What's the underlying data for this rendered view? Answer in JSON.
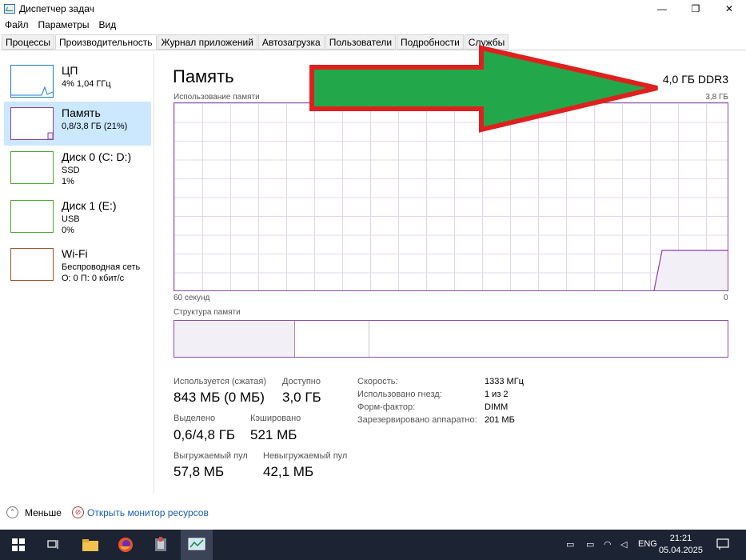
{
  "window": {
    "title": "Диспетчер задач",
    "minimize_glyph": "—",
    "restore_glyph": "❐",
    "close_glyph": "✕"
  },
  "menu": [
    "Файл",
    "Параметры",
    "Вид"
  ],
  "tabs": [
    {
      "label": "Процессы",
      "active": false
    },
    {
      "label": "Производительность",
      "active": true
    },
    {
      "label": "Журнал приложений",
      "active": false
    },
    {
      "label": "Автозагрузка",
      "active": false
    },
    {
      "label": "Пользователи",
      "active": false
    },
    {
      "label": "Подробности",
      "active": false
    },
    {
      "label": "Службы",
      "active": false
    }
  ],
  "sidebar": {
    "items": [
      {
        "name": "ЦП",
        "line1": "4% 1,04 ГГц",
        "line2": "",
        "color": "#1c7bd0"
      },
      {
        "name": "Память",
        "line1": "0,8/3,8 ГБ (21%)",
        "line2": "",
        "color": "#8b3fa8"
      },
      {
        "name": "Диск 0 (C: D:)",
        "line1": "SSD",
        "line2": "1%",
        "color": "#4ea72e"
      },
      {
        "name": "Диск 1 (E:)",
        "line1": "USB",
        "line2": "0%",
        "color": "#4ea72e"
      },
      {
        "name": "Wi-Fi",
        "line1": "Беспроводная сеть",
        "line2": "О: 0 П: 0 кбит/с",
        "color": "#a0522d"
      }
    ]
  },
  "main": {
    "title": "Память",
    "mem_type": "4,0 ГБ DDR3",
    "usage_label": "Использование памяти",
    "usage_max": "3,8 ГБ",
    "time_left": "60 секунд",
    "time_right": "0",
    "structure_label": "Структура памяти",
    "stats": {
      "in_use_label": "Используется (сжатая)",
      "in_use_value": "843 МБ (0 МБ)",
      "available_label": "Доступно",
      "available_value": "3,0 ГБ",
      "committed_label": "Выделено",
      "committed_value": "0,6/4,8 ГБ",
      "cached_label": "Кэшировано",
      "cached_value": "521 МБ",
      "paged_label": "Выгружаемый пул",
      "paged_value": "57,8 МБ",
      "nonpaged_label": "Невыгружаемый пул",
      "nonpaged_value": "42,1 МБ"
    },
    "details": [
      {
        "label": "Скорость:",
        "value": "1333 МГц"
      },
      {
        "label": "Использовано гнезд:",
        "value": "1 из 2"
      },
      {
        "label": "Форм-фактор:",
        "value": "DIMM"
      },
      {
        "label": "Зарезервировано аппаратно:",
        "value": "201 МБ"
      }
    ]
  },
  "bottom": {
    "less_label": "Меньше",
    "monitor_label": "Открыть монитор ресурсов"
  },
  "taskbar": {
    "lang": "ENG",
    "time": "21:21",
    "date": "05.04.2025"
  },
  "colors": {
    "memory_accent": "#8b3fa8",
    "arrow_fill": "#22a84a",
    "arrow_stroke": "#e0201e",
    "selected_bg": "#cce8ff"
  }
}
